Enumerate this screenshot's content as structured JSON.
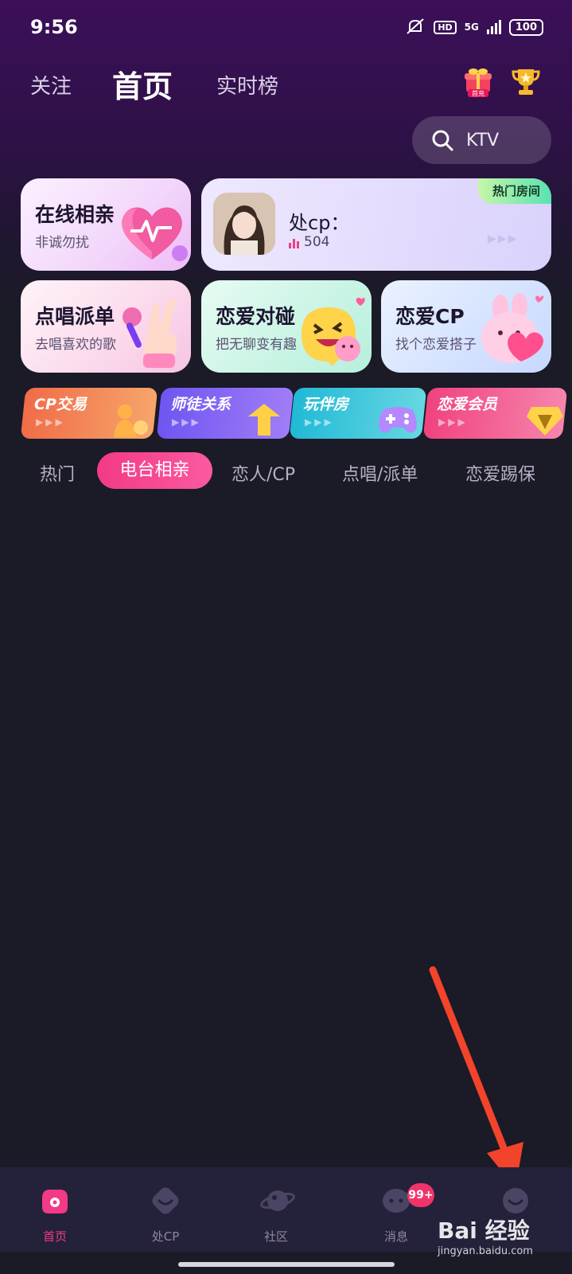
{
  "status": {
    "time": "9:56",
    "network": "5G",
    "hd": "HD",
    "battery": "100"
  },
  "topnav": {
    "tabs": [
      "关注",
      "首页",
      "实时榜"
    ],
    "gift_badge": "首充"
  },
  "search": {
    "placeholder": "KTV"
  },
  "cards": {
    "online": {
      "title": "在线相亲",
      "subtitle": "非诚勿扰"
    },
    "room": {
      "badge": "热门房间",
      "name": "处cp：",
      "count": "504"
    },
    "sing": {
      "title": "点唱派单",
      "subtitle": "去唱喜欢的歌"
    },
    "match": {
      "title": "恋爱对碰",
      "subtitle": "把无聊变有趣"
    },
    "love": {
      "title": "恋爱CP",
      "subtitle": "找个恋爱搭子"
    }
  },
  "mini_cards": [
    "CP交易",
    "师徒关系",
    "玩伴房",
    "恋爱会员"
  ],
  "categories": {
    "items": [
      "热门",
      "电台相亲",
      "恋人/CP",
      "点唱/派单",
      "恋爱踢保"
    ],
    "active": "电台相亲"
  },
  "bottom_nav": {
    "items": [
      "首页",
      "处CP",
      "社区",
      "消息",
      ""
    ],
    "active": "首页",
    "message_badge": "99+"
  },
  "watermark": {
    "main": "Bai 经验",
    "sub": "jingyan.baidu.com"
  },
  "colors": {
    "accent": "#f33a86",
    "background": "#1b1a27",
    "nav_bg": "#24213a"
  }
}
